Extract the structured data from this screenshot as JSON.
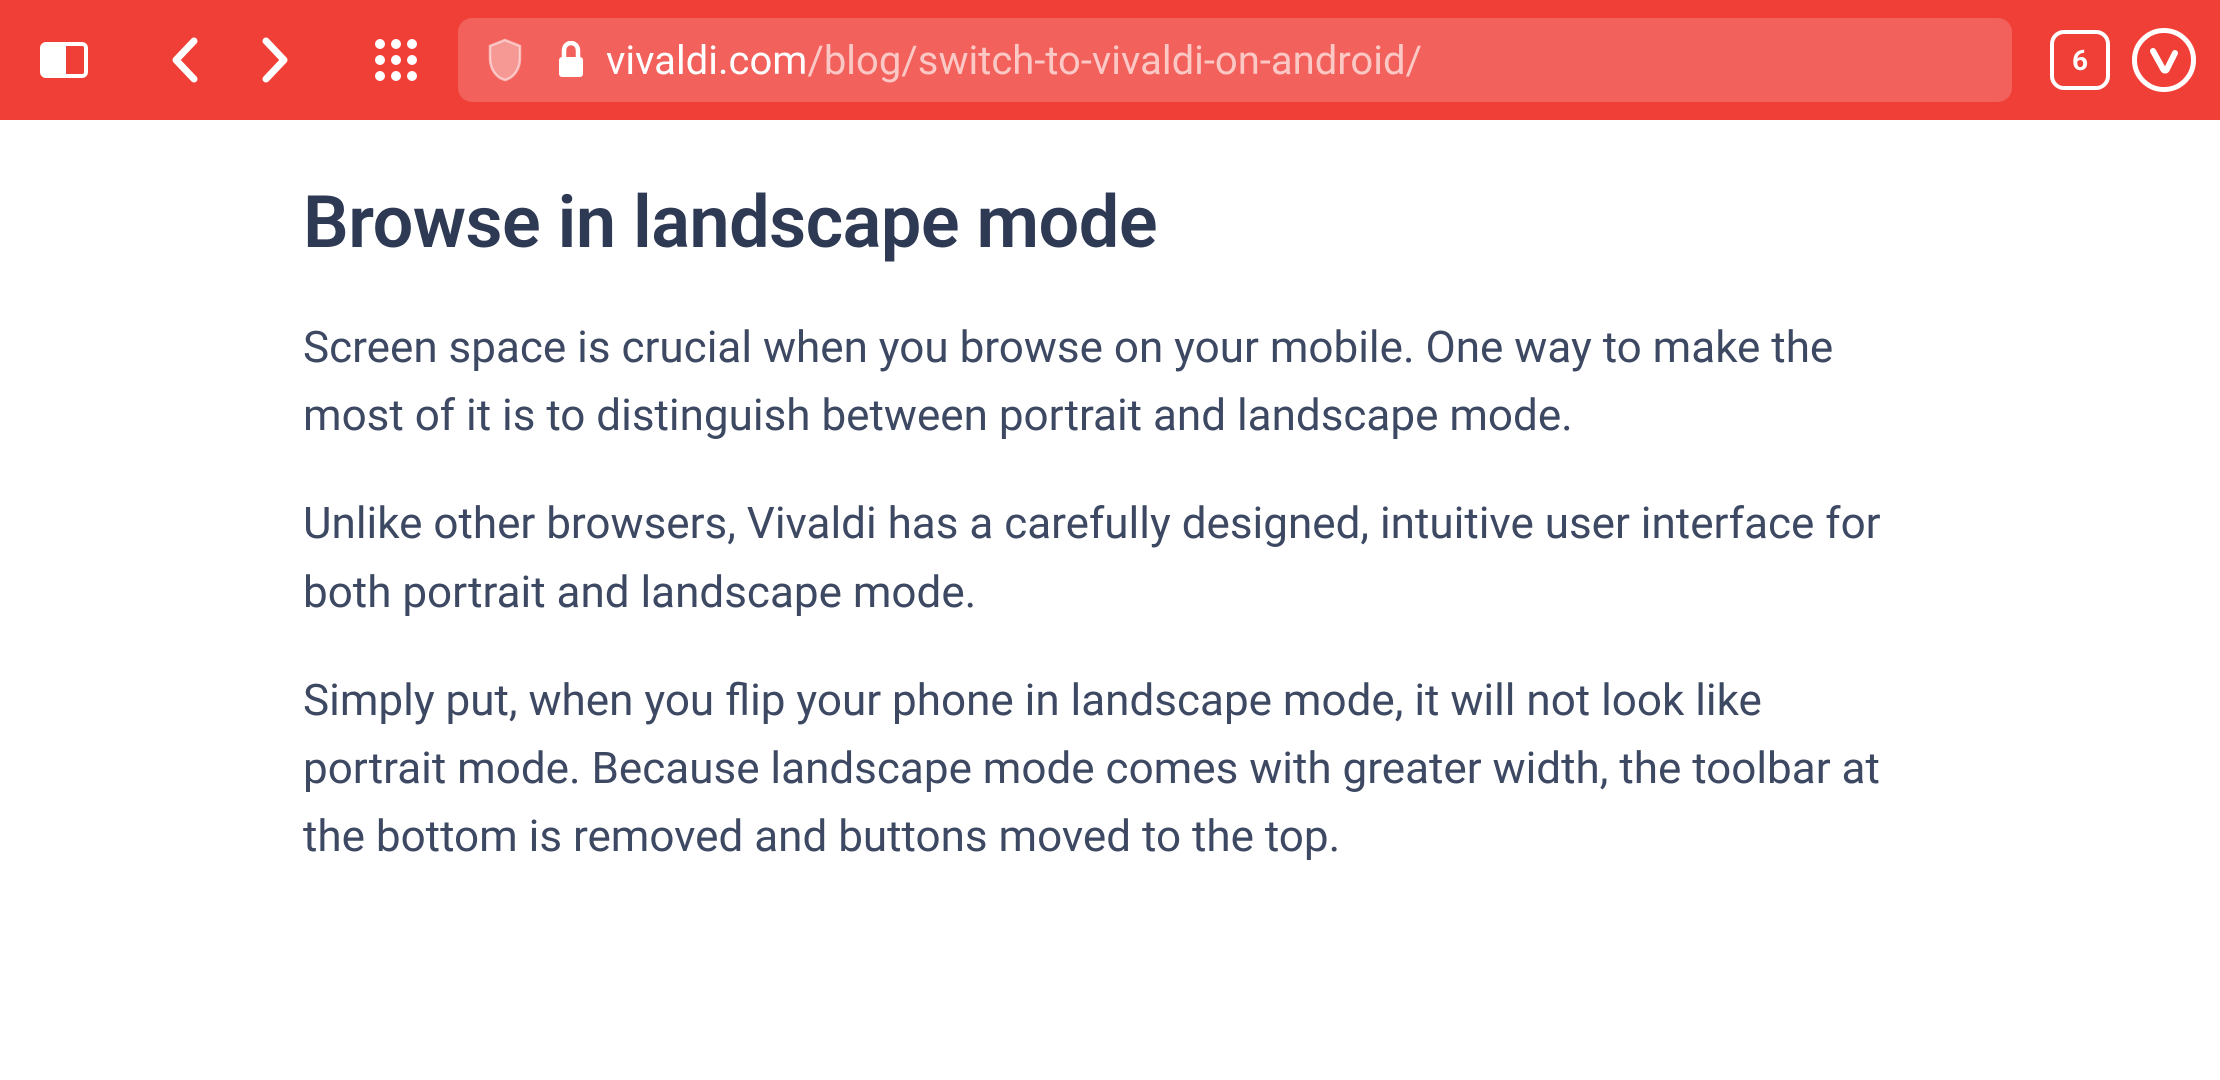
{
  "toolbar": {
    "tab_count": "6",
    "url_domain": "vivaldi.com",
    "url_path": "/blog/switch-to-vivaldi-on-android/"
  },
  "article": {
    "heading": "Browse in landscape mode",
    "paragraphs": [
      "Screen space is crucial when you browse on your mobile. One way to make the most of it is to distinguish between portrait and landscape mode.",
      "Unlike other browsers, Vivaldi has a carefully designed, intuitive user interface for both portrait and landscape mode.",
      "Simply put, when you flip your phone in landscape mode, it will not look like portrait mode. Because landscape mode comes with greater width, the toolbar at the bottom is removed and buttons moved to the top."
    ]
  }
}
